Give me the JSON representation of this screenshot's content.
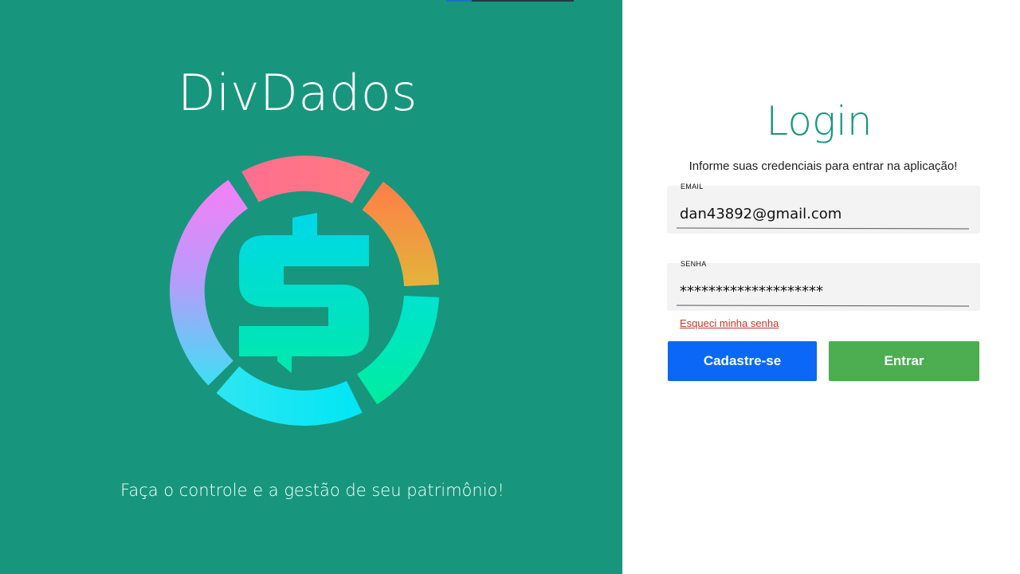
{
  "brand": {
    "name": "DivDados",
    "tagline": "Faça o controle e a gestão de seu patrimônio!"
  },
  "login": {
    "title": "Login",
    "subtitle": "Informe suas credenciais para entrar na aplicação!",
    "email": {
      "label": "EMAIL",
      "value": "dan43892@gmail.com"
    },
    "password": {
      "label": "SENHA",
      "value": "********************"
    },
    "forgot_label": "Esqueci minha senha",
    "register_label": "Cadastre-se",
    "enter_label": "Entrar"
  },
  "colors": {
    "brand_green": "#17967d",
    "register_blue": "#0b68f6",
    "enter_green": "#4cae51",
    "forgot_red": "#c0392b"
  }
}
